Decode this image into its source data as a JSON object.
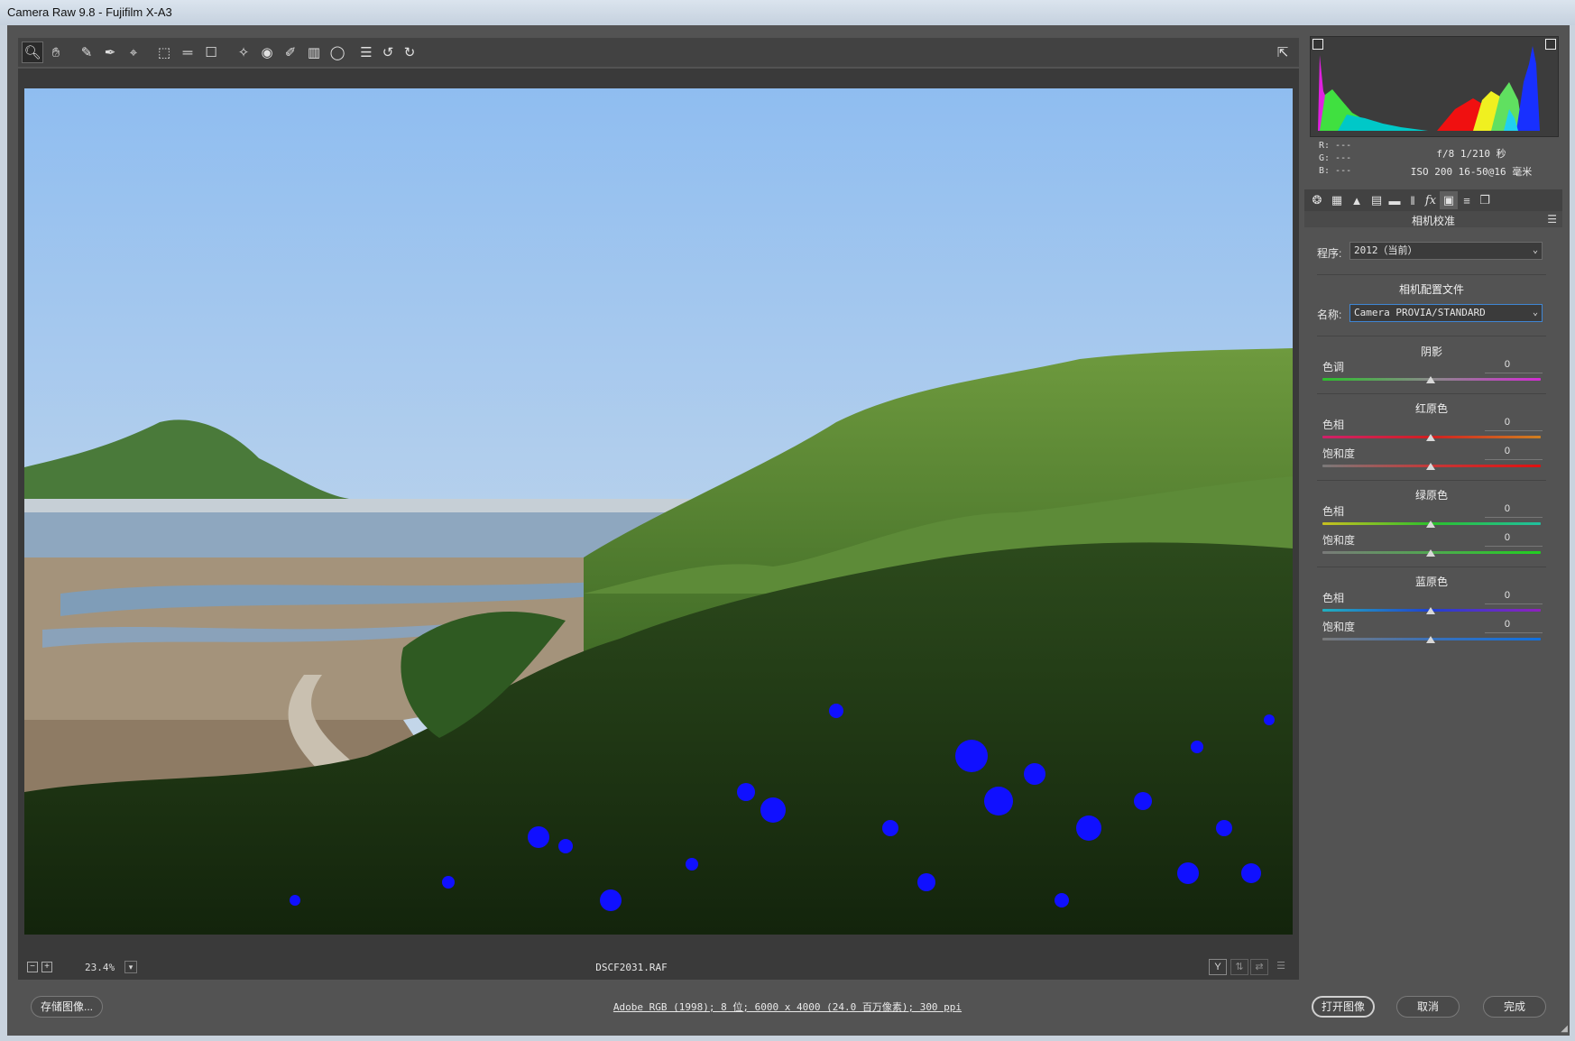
{
  "window": {
    "title": "Camera Raw 9.8 -  Fujifilm X-A3"
  },
  "toolbar": {
    "tools": [
      "zoom-icon",
      "hand-icon",
      "white-balance-icon",
      "color-sampler-icon",
      "target-adjust-icon",
      "crop-icon",
      "straighten-icon",
      "transform-icon",
      "spot-removal-icon",
      "red-eye-icon",
      "adjustment-brush-icon",
      "graduated-filter-icon",
      "radial-filter-icon",
      "presets-list-icon",
      "rotate-ccw-icon",
      "rotate-cw-icon"
    ],
    "fullscreen_icon": "fullscreen-icon"
  },
  "info": {
    "r": "R:  ---",
    "g": "G:  ---",
    "b": "B:  ---",
    "exposure": "f/8  1/210 秒",
    "iso_lens": "ISO 200  16-50@16 毫米"
  },
  "panel": {
    "title": "相机校准",
    "process_label": "程序:",
    "process_value": "2012（当前）",
    "profile_header": "相机配置文件",
    "name_label": "名称:",
    "name_value": "Camera PROVIA/STANDARD",
    "shadows": {
      "header": "阴影",
      "tint_label": "色调",
      "tint_value": "0"
    },
    "red": {
      "header": "红原色",
      "hue_label": "色相",
      "hue_value": "0",
      "sat_label": "饱和度",
      "sat_value": "0"
    },
    "green": {
      "header": "绿原色",
      "hue_label": "色相",
      "hue_value": "0",
      "sat_label": "饱和度",
      "sat_value": "0"
    },
    "blue": {
      "header": "蓝原色",
      "hue_label": "色相",
      "hue_value": "0",
      "sat_label": "饱和度",
      "sat_value": "0"
    }
  },
  "statusbar": {
    "zoom": "23.4%",
    "filename": "DSCF2031.RAF",
    "view_y": "Y"
  },
  "bottom": {
    "save_label": "存储图像...",
    "workflow_link": "Adobe RGB (1998); 8 位; 6000 x 4000 (24.0 百万像素); 300 ppi",
    "open_label": "打开图像",
    "cancel_label": "取消",
    "done_label": "完成"
  },
  "colors": {
    "accent": "#3f86d4",
    "clipping": "#1010ff"
  }
}
